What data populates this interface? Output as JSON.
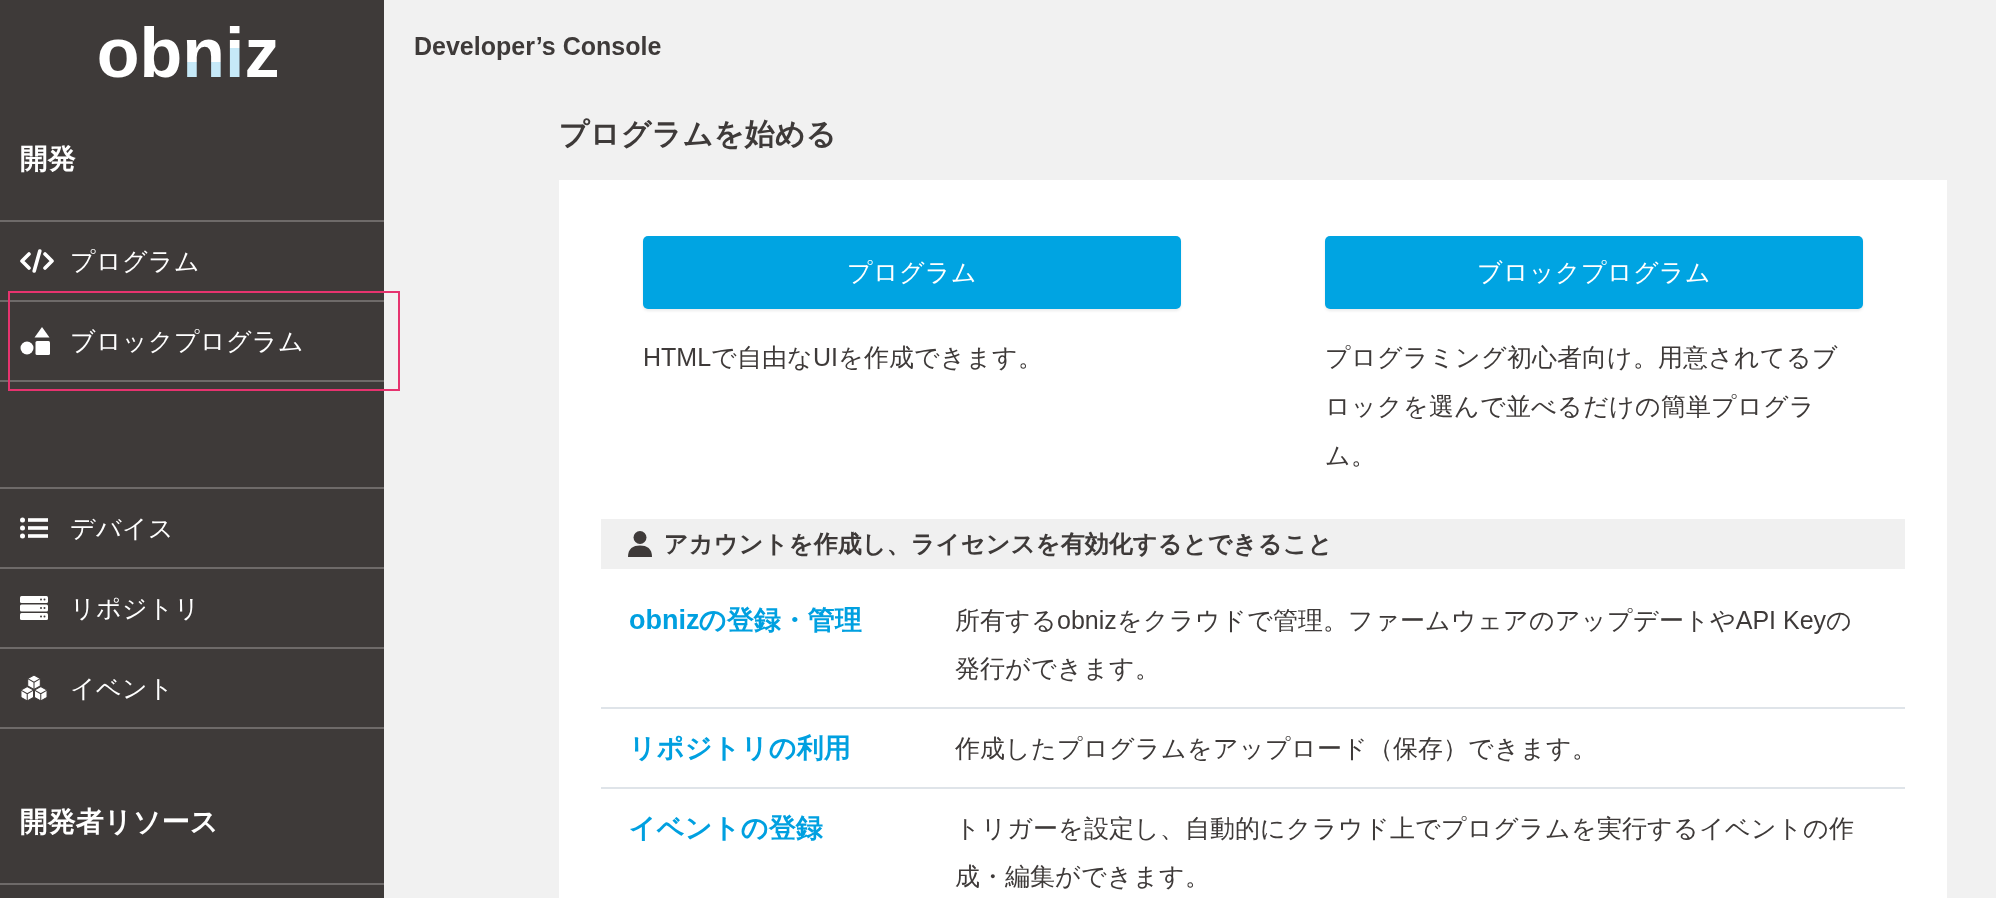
{
  "sidebar": {
    "logo": "obniz",
    "sections": [
      {
        "heading": "開発",
        "items": [
          {
            "label": "プログラム",
            "highlighted": false
          },
          {
            "label": "ブロックプログラム",
            "highlighted": true
          }
        ]
      },
      {
        "items": [
          {
            "label": "デバイス",
            "highlighted": false
          },
          {
            "label": "リポジトリ",
            "highlighted": false
          },
          {
            "label": "イベント",
            "highlighted": false
          }
        ]
      },
      {
        "heading": "開発者リソース"
      }
    ]
  },
  "header": {
    "title": "Developer’s Console"
  },
  "start": {
    "heading": "プログラムを始める",
    "options": [
      {
        "button": "プログラム",
        "description": "HTMLで自由なUIを作成できます。"
      },
      {
        "button": "ブロックプログラム",
        "description": "プログラミング初心者向け。用意されてるブロックを選んで並べるだけの簡単プログラム。"
      }
    ]
  },
  "features": {
    "heading": "アカウントを作成し、ライセンスを有効化するとできること",
    "rows": [
      {
        "name": "obnizの登録・管理",
        "description": "所有するobnizをクラウドで管理。ファームウェアのアップデートやAPI Keyの発行ができます。"
      },
      {
        "name": "リポジトリの利用",
        "description": "作成したプログラムをアップロード（保存）できます。"
      },
      {
        "name": "イベントの登録",
        "description": "トリガーを設定し、自動的にクラウド上でプログラムを実行するイベントの作成・編集ができます。"
      }
    ]
  }
}
